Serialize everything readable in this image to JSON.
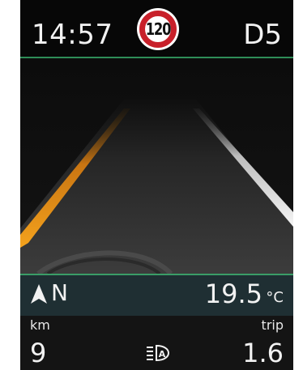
{
  "status_bar": {
    "time": "14:57",
    "speed_limit": "120",
    "gear": "D5"
  },
  "info": {
    "compass_icon": "navigation-arrow-icon",
    "heading": "N",
    "temperature": "19.5",
    "temperature_unit": "°C",
    "range_label": "km",
    "range_value": "9",
    "trip_label": "trip",
    "trip_value": "1.6",
    "center_icon": "auto-headlight-icon"
  },
  "colors": {
    "accent_green": "#2e8d57",
    "lane_orange": "#f19a1c",
    "sign_red": "#c8202a"
  }
}
